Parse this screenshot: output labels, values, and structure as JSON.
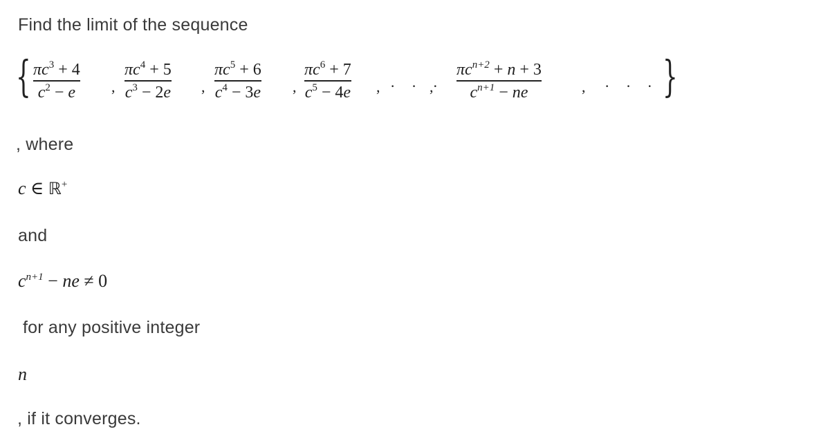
{
  "problem": {
    "intro": "Find the limit of the sequence",
    "sequence": {
      "open_brace": "{",
      "close_brace": "}",
      "terms": [
        {
          "num_coef": "π",
          "num_var": "c",
          "num_exp": "3",
          "num_rest": " + 4",
          "den_var": "c",
          "den_exp": "2",
          "den_rest": " − ",
          "den_e": "e"
        },
        {
          "num_coef": "π",
          "num_var": "c",
          "num_exp": "4",
          "num_rest": " + 5",
          "den_var": "c",
          "den_exp": "3",
          "den_rest": " − 2",
          "den_e": "e"
        },
        {
          "num_coef": "π",
          "num_var": "c",
          "num_exp": "5",
          "num_rest": " + 6",
          "den_var": "c",
          "den_exp": "4",
          "den_rest": " − 3",
          "den_e": "e"
        },
        {
          "num_coef": "π",
          "num_var": "c",
          "num_exp": "6",
          "num_rest": " + 7",
          "den_var": "c",
          "den_exp": "5",
          "den_rest": " − 4",
          "den_e": "e"
        }
      ],
      "general_term": {
        "num_coef": "π",
        "num_var": "c",
        "num_exp": "n+2",
        "num_rest_1": " + ",
        "num_n": "n",
        "num_rest_2": " + 3",
        "den_var": "c",
        "den_exp": "n+1",
        "den_rest": " − ",
        "den_ne": "ne"
      },
      "separator": ",",
      "ellipsis": "· · ·"
    },
    "where_text": ", where",
    "condition_1": {
      "var": "c",
      "rel": " ∈ ",
      "set": "ℝ",
      "set_sup": "+"
    },
    "and_text": "and",
    "condition_2": {
      "var": "c",
      "exp": "n+1",
      "minus": " − ",
      "ne": "ne",
      "neq": " ≠ 0"
    },
    "for_text": "for any positive integer",
    "n_symbol": "n",
    "closing_text": ", if it converges."
  }
}
